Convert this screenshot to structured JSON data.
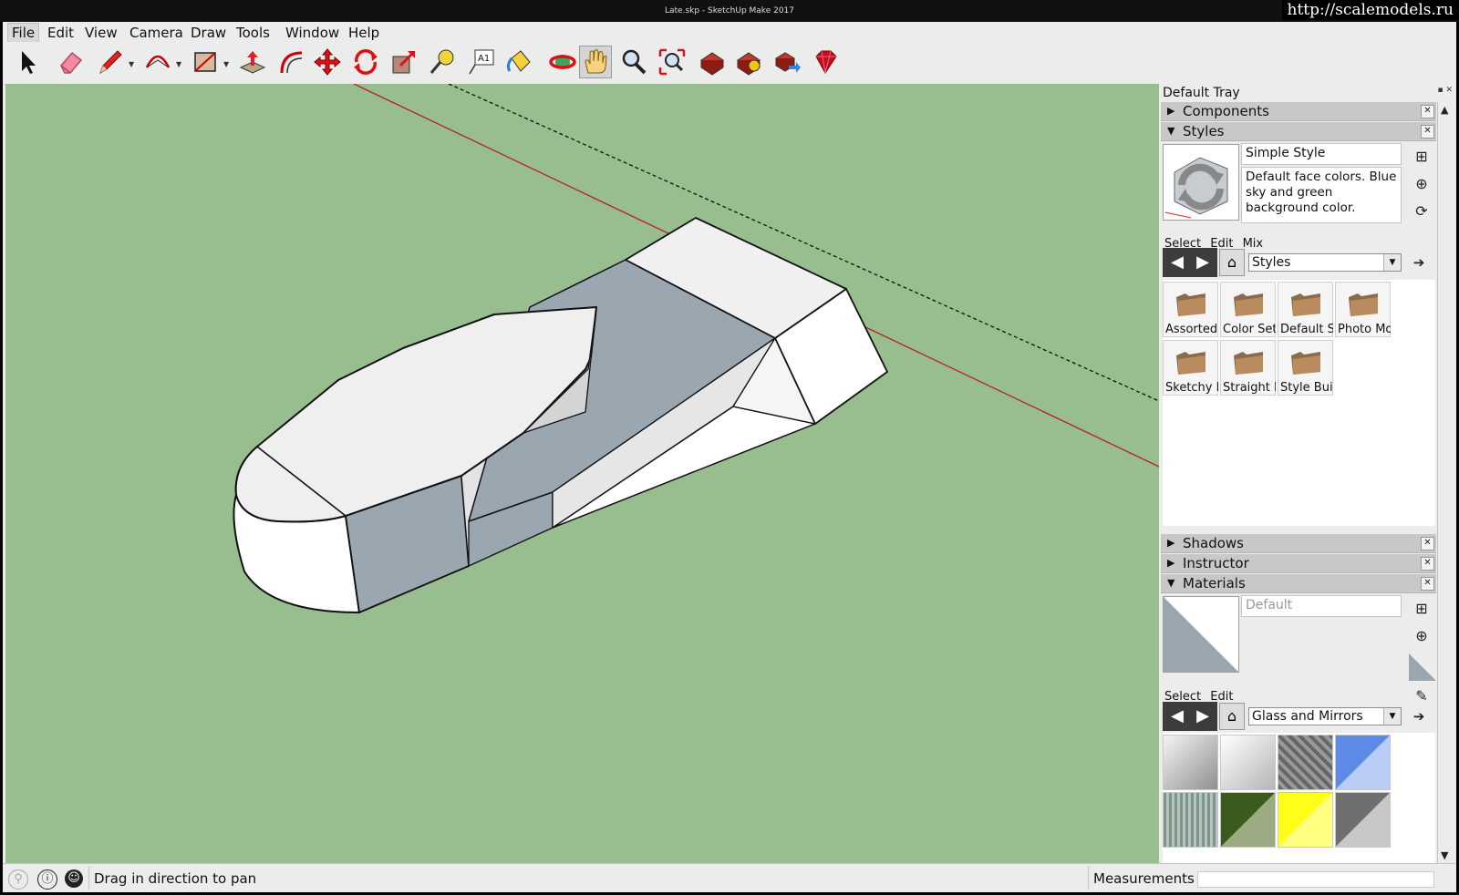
{
  "window": {
    "title": "Late.skp - SketchUp Make 2017"
  },
  "watermark": "http://scalemodels.ru",
  "menu": [
    "File",
    "Edit",
    "View",
    "Camera",
    "Draw",
    "Tools",
    "Window",
    "Help"
  ],
  "toolbar": {
    "tools": [
      {
        "name": "select-tool",
        "icon": "arrow-cursor-icon"
      },
      {
        "name": "eraser-tool",
        "icon": "eraser-icon"
      },
      {
        "name": "line-tool",
        "icon": "pencil-icon"
      },
      {
        "name": "arc-tool",
        "icon": "arc-icon"
      },
      {
        "name": "rectangle-tool",
        "icon": "rectangle-icon"
      },
      {
        "name": "push-pull-tool",
        "icon": "push-pull-icon"
      },
      {
        "name": "offset-tool",
        "icon": "offset-icon"
      },
      {
        "name": "move-tool",
        "icon": "move-arrows-icon"
      },
      {
        "name": "rotate-tool",
        "icon": "rotate-icon"
      },
      {
        "name": "scale-tool",
        "icon": "scale-icon"
      },
      {
        "name": "tape-measure-tool",
        "icon": "tape-measure-icon"
      },
      {
        "name": "text-tool",
        "icon": "text-label-icon"
      },
      {
        "name": "paint-bucket-tool",
        "icon": "paint-bucket-icon"
      },
      {
        "name": "orbit-tool",
        "icon": "orbit-icon"
      },
      {
        "name": "pan-tool",
        "icon": "hand-icon"
      },
      {
        "name": "zoom-tool",
        "icon": "magnifier-icon"
      },
      {
        "name": "zoom-extents-tool",
        "icon": "zoom-extents-icon"
      },
      {
        "name": "warehouse-tool",
        "icon": "3d-warehouse-icon"
      },
      {
        "name": "extension-warehouse-tool",
        "icon": "extension-warehouse-icon"
      },
      {
        "name": "share-model-tool",
        "icon": "share-model-icon"
      },
      {
        "name": "ruby-console-tool",
        "icon": "ruby-gem-icon"
      }
    ],
    "text_tool_label": "A1",
    "active_tool": "pan-tool"
  },
  "tray": {
    "title": "Default Tray",
    "components": {
      "label": "Components",
      "expanded": false
    },
    "styles": {
      "label": "Styles",
      "expanded": true,
      "style_name": "Simple Style",
      "style_description": "Default face colors. Blue sky and green background color.",
      "tabs": [
        "Select",
        "Edit",
        "Mix"
      ],
      "collection": "Styles",
      "folders": [
        "Assorted Styles",
        "Color Sets",
        "Default Styles",
        "Photo Modeling",
        "Sketchy Edges",
        "Straight Lines",
        "Style Builder"
      ]
    },
    "shadows": {
      "label": "Shadows",
      "expanded": false
    },
    "instructor": {
      "label": "Instructor",
      "expanded": false
    },
    "materials": {
      "label": "Materials",
      "expanded": true,
      "material_name": "Default",
      "tabs": [
        "Select",
        "Edit"
      ],
      "collection": "Glass and Mirrors",
      "swatch_colors": [
        "#bdbdbd",
        "#e2e2e2",
        "#8a8a8a",
        "#6f95e8",
        "#8fa39b",
        "#556b2f",
        "#ffff3c",
        "#7d7d7d"
      ]
    }
  },
  "status": {
    "message": "Drag in direction to pan",
    "measurements_label": "Measurements",
    "measurements_value": ""
  },
  "colors": {
    "ground": "#98bd8e",
    "red_axis": "#b22222",
    "face_front": "#ffffff",
    "face_back": "#9aa7b1"
  }
}
